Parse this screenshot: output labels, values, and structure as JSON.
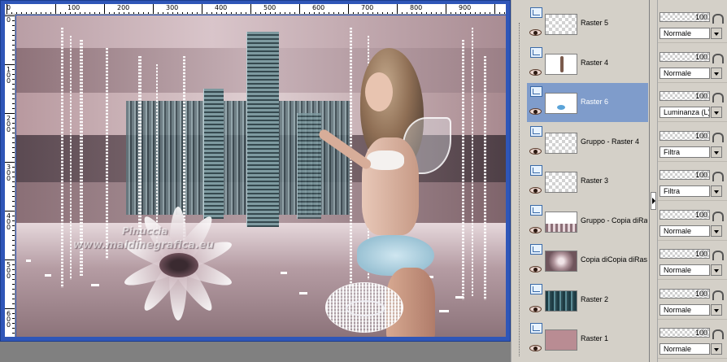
{
  "canvas": {
    "ruler_top_labels": [
      "0",
      "100",
      "200",
      "300",
      "400",
      "500",
      "600",
      "700",
      "800",
      "900"
    ],
    "ruler_left_labels": [
      "0",
      "100",
      "200",
      "300",
      "400",
      "500",
      "600"
    ],
    "watermark_line1": "Pinuccia",
    "watermark_line2": "www.maldinegrafica.eu"
  },
  "layers": [
    {
      "name": "Raster 5",
      "opacity": "100",
      "blend": "Normale",
      "selected": false,
      "thumb": "transparent"
    },
    {
      "name": "Raster 4",
      "opacity": "100",
      "blend": "Normale",
      "selected": false,
      "thumb": "figure"
    },
    {
      "name": "Raster 6",
      "opacity": "100",
      "blend": "Luminanza (L)",
      "selected": true,
      "thumb": "blue-dot"
    },
    {
      "name": "Gruppo - Raster 4",
      "opacity": "100",
      "blend": "Filtra",
      "selected": false,
      "thumb": "transparent"
    },
    {
      "name": "Raster 3",
      "opacity": "100",
      "blend": "Filtra",
      "selected": false,
      "thumb": "transparent"
    },
    {
      "name": "Gruppo - Copia diRas",
      "opacity": "100",
      "blend": "Normale",
      "selected": false,
      "thumb": "stripes"
    },
    {
      "name": "Copia diCopia diRas",
      "opacity": "100",
      "blend": "Normale",
      "selected": false,
      "thumb": "pattern"
    },
    {
      "name": "Raster 2",
      "opacity": "100",
      "blend": "Normale",
      "selected": false,
      "thumb": "city"
    },
    {
      "name": "Raster 1",
      "opacity": "100",
      "blend": "Normale",
      "selected": false,
      "thumb": "pink"
    }
  ],
  "colors": {
    "window_frame": "#2f56b8",
    "selected_row": "#7f9ccb",
    "panel_bg": "#d4d0c8",
    "raster1_fill": "#b98c93"
  }
}
